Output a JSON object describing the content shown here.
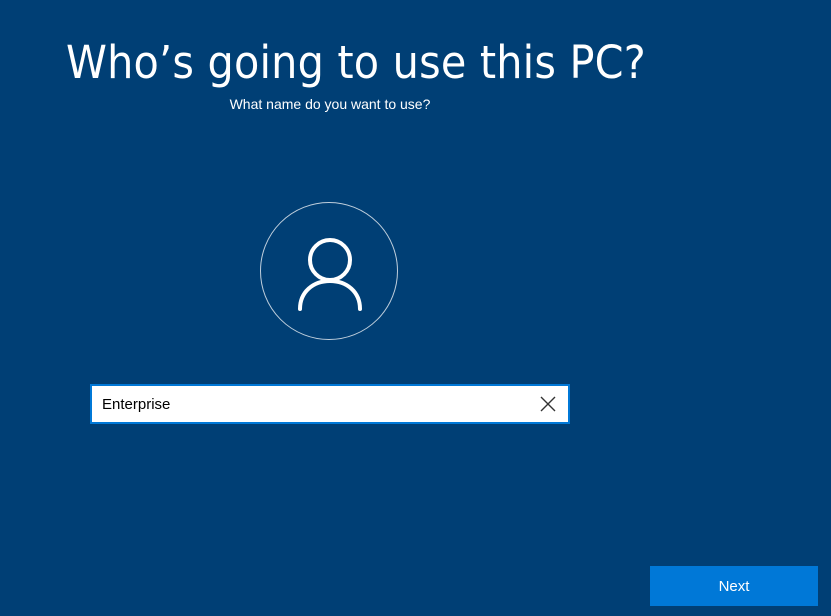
{
  "header": {
    "title": "Who’s going to use this PC?",
    "subtitle": "What name do you want to use?"
  },
  "form": {
    "name_value": "Enterprise",
    "clear_icon": "close-icon"
  },
  "avatar": {
    "icon": "user-icon"
  },
  "footer": {
    "next_label": "Next"
  },
  "colors": {
    "background": "#003f75",
    "accent": "#0078d7",
    "text": "#ffffff"
  }
}
